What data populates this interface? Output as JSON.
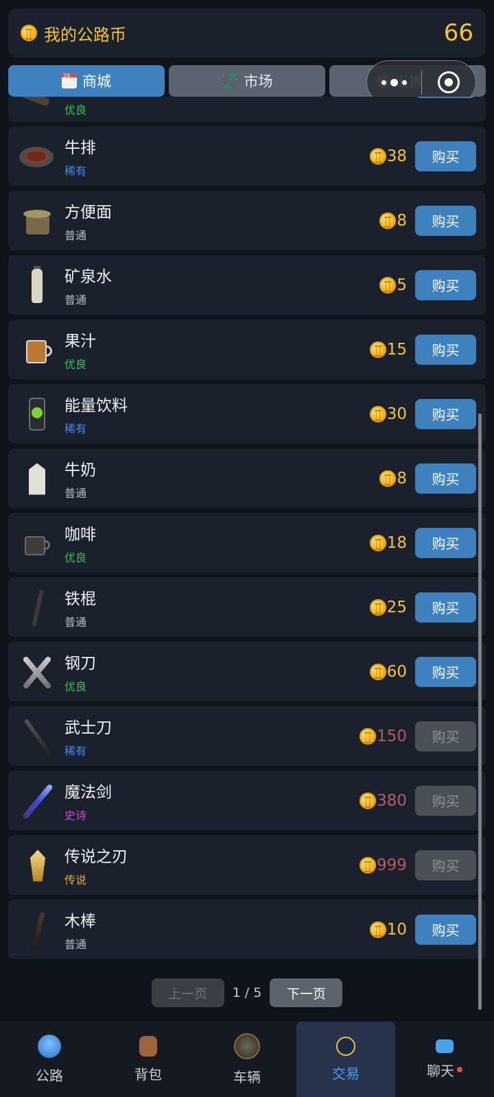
{
  "header": {
    "title": "我的公路币",
    "balance": "66",
    "coin_icon": "coin-icon"
  },
  "tabs": [
    {
      "label": "商城",
      "icon": "shop-24h-icon",
      "active": true
    },
    {
      "label": "市场",
      "icon": "currency-exchange-icon",
      "active": false
    },
    {
      "label": "出售",
      "icon": "money-bag-icon",
      "active": false
    }
  ],
  "partial_row": {
    "rarity": "优良"
  },
  "items": [
    {
      "name": "牛排",
      "rarity": "稀有",
      "price": "38",
      "buy": "购买",
      "enabled": true,
      "icon": "steak-icon"
    },
    {
      "name": "方便面",
      "rarity": "普通",
      "price": "8",
      "buy": "购买",
      "enabled": true,
      "icon": "instant-noodle-icon"
    },
    {
      "name": "矿泉水",
      "rarity": "普通",
      "price": "5",
      "buy": "购买",
      "enabled": true,
      "icon": "water-bottle-icon"
    },
    {
      "name": "果汁",
      "rarity": "优良",
      "price": "15",
      "buy": "购买",
      "enabled": true,
      "icon": "juice-icon"
    },
    {
      "name": "能量饮料",
      "rarity": "稀有",
      "price": "30",
      "buy": "购买",
      "enabled": true,
      "icon": "energy-drink-icon"
    },
    {
      "name": "牛奶",
      "rarity": "普通",
      "price": "8",
      "buy": "购买",
      "enabled": true,
      "icon": "milk-carton-icon"
    },
    {
      "name": "咖啡",
      "rarity": "优良",
      "price": "18",
      "buy": "购买",
      "enabled": true,
      "icon": "coffee-cup-icon"
    },
    {
      "name": "铁棍",
      "rarity": "普通",
      "price": "25",
      "buy": "购买",
      "enabled": true,
      "icon": "iron-rod-icon"
    },
    {
      "name": "钢刀",
      "rarity": "优良",
      "price": "60",
      "buy": "购买",
      "enabled": true,
      "icon": "steel-blades-icon"
    },
    {
      "name": "武士刀",
      "rarity": "稀有",
      "price": "150",
      "buy": "购买",
      "enabled": false,
      "icon": "katana-icon"
    },
    {
      "name": "魔法剑",
      "rarity": "史诗",
      "price": "380",
      "buy": "购买",
      "enabled": false,
      "icon": "magic-sword-icon"
    },
    {
      "name": "传说之刃",
      "rarity": "传说",
      "price": "999",
      "buy": "购买",
      "enabled": false,
      "icon": "legend-blade-icon"
    },
    {
      "name": "木棒",
      "rarity": "普通",
      "price": "10",
      "buy": "购买",
      "enabled": true,
      "icon": "wooden-club-icon"
    }
  ],
  "rarity_colors": {
    "普通": "#b9bec7",
    "优良": "#38c155",
    "稀有": "#4a86e8",
    "史诗": "#c24bd8",
    "传说": "#f0a431"
  },
  "pager": {
    "prev": "上一页",
    "info": "1 / 5",
    "next": "下一页"
  },
  "nav": [
    {
      "label": "公路",
      "icon": "road-globe-icon"
    },
    {
      "label": "背包",
      "icon": "backpack-icon"
    },
    {
      "label": "车辆",
      "icon": "vehicle-icon"
    },
    {
      "label": "交易",
      "icon": "trade-icon",
      "active": true
    },
    {
      "label": "聊天",
      "icon": "chat-icon",
      "badge": true
    }
  ],
  "colors": {
    "accent": "#3f80bf",
    "gold": "#f5c33b",
    "background": "#0f131b",
    "card": "#1b212c"
  }
}
